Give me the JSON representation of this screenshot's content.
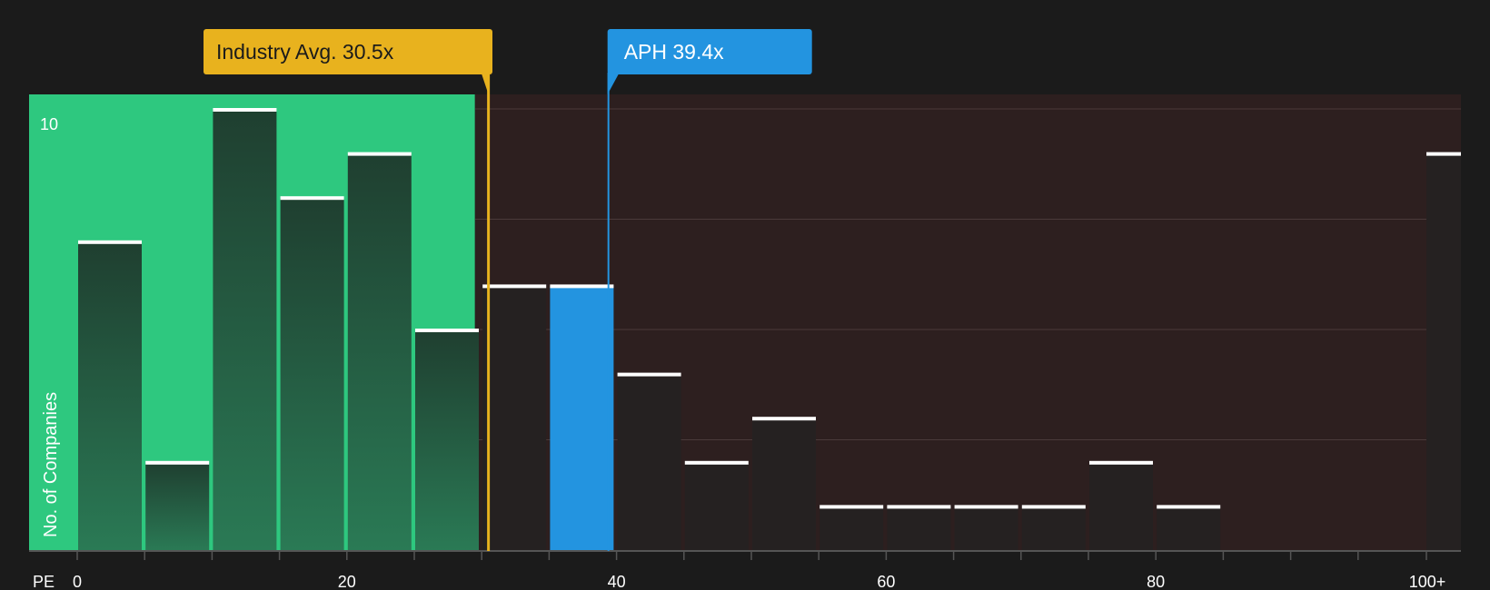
{
  "chart_data": {
    "type": "bar",
    "xlabel": "PE",
    "ylabel": "No. of Companies",
    "ylim": [
      0,
      10
    ],
    "y_tick_labels": [
      "10"
    ],
    "x_tick_labels": [
      "0",
      "20",
      "40",
      "60",
      "80",
      "100+"
    ],
    "bin_width": 5,
    "bins": [
      {
        "start": 0,
        "value": 7
      },
      {
        "start": 5,
        "value": 2
      },
      {
        "start": 10,
        "value": 10
      },
      {
        "start": 15,
        "value": 8
      },
      {
        "start": 20,
        "value": 9
      },
      {
        "start": 25,
        "value": 5
      },
      {
        "start": 30,
        "value": 6
      },
      {
        "start": 35,
        "value": 6,
        "highlight": true
      },
      {
        "start": 40,
        "value": 4
      },
      {
        "start": 45,
        "value": 2
      },
      {
        "start": 50,
        "value": 3
      },
      {
        "start": 55,
        "value": 1
      },
      {
        "start": 60,
        "value": 1
      },
      {
        "start": 65,
        "value": 1
      },
      {
        "start": 70,
        "value": 1
      },
      {
        "start": 75,
        "value": 2
      },
      {
        "start": 80,
        "value": 1
      },
      {
        "start": 100,
        "value": 9
      }
    ],
    "markers": {
      "industry": {
        "label": "Industry Avg. 30.5x",
        "value": 30.5
      },
      "company": {
        "label": "APH 39.4x",
        "value": 39.4
      }
    },
    "undervalued_region_max": 29.5,
    "colors": {
      "background": "#1b1b1b",
      "undervalued": "#2ec87f",
      "overvalued": "#2d1f1f",
      "industry_marker": "#e8b21e",
      "company_marker": "#2394e0",
      "bar_on_green": "#1e4a36",
      "bar_dark": "#252121",
      "cap": "#ffffff"
    }
  }
}
